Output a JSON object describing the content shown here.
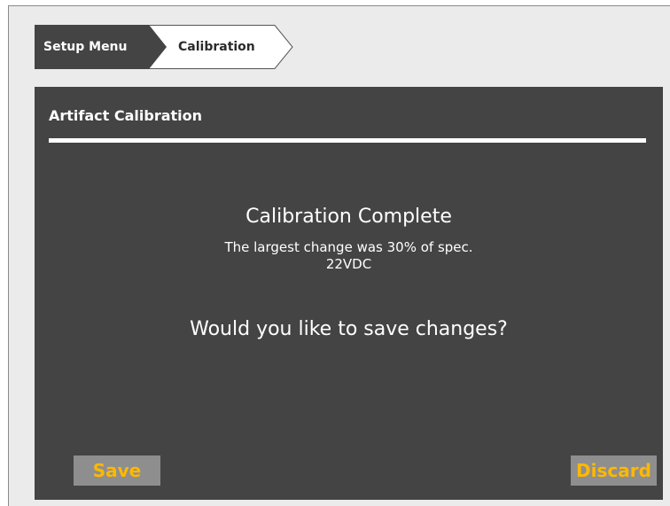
{
  "breadcrumb": {
    "items": [
      {
        "label": "Setup Menu"
      },
      {
        "label": "Calibration"
      }
    ]
  },
  "panel": {
    "title": "Artifact Calibration"
  },
  "message": {
    "heading": "Calibration Complete",
    "detail": "The largest change was 30% of spec.",
    "value": "22VDC",
    "question": "Would you like to save changes?"
  },
  "actions": {
    "save_label": "Save",
    "discard_label": "Discard"
  },
  "colors": {
    "breadcrumb_active": "#444444",
    "breadcrumb_inactive": "#ffffff",
    "panel_bg": "#444444",
    "screen_bg": "#ebebeb",
    "button_bg": "#8e8e8e",
    "button_text": "#ffb800"
  }
}
